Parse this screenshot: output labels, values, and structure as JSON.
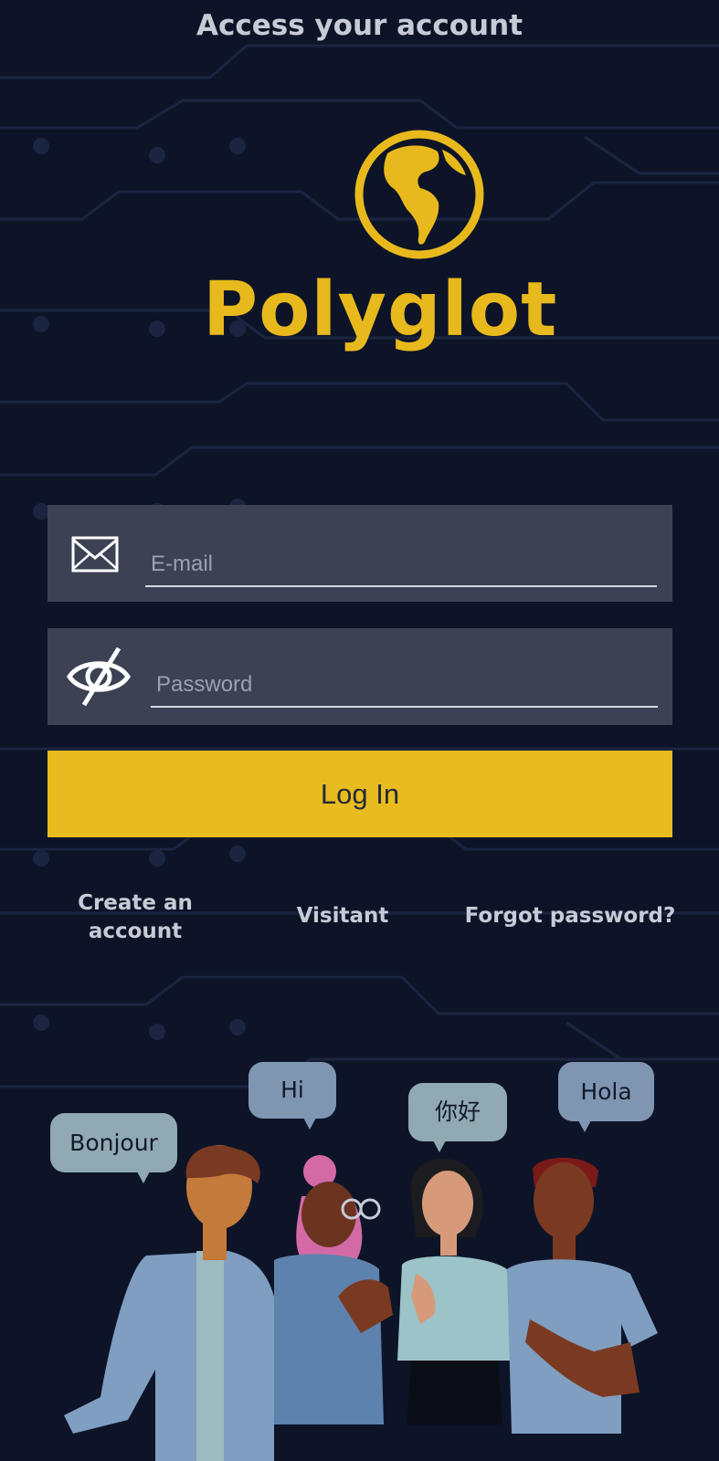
{
  "header": {
    "title": "Access your account"
  },
  "logo": {
    "text": "Polyglot",
    "icon": "globe-americas-icon",
    "color": "#e8b91c"
  },
  "form": {
    "email": {
      "placeholder": "E-mail",
      "value": "",
      "icon": "envelope-icon"
    },
    "password": {
      "placeholder": "Password",
      "value": "",
      "icon": "eye-off-icon"
    },
    "login_label": "Log In"
  },
  "links": {
    "create_account": "Create an account",
    "visitant": "Visitant",
    "forgot_password": "Forgot password?"
  },
  "illustration": {
    "bubbles": [
      "Bonjour",
      "Hi",
      "你好",
      "Hola"
    ]
  },
  "colors": {
    "background": "#0d1428",
    "accent": "#e8bb1f",
    "field": "#3c4254",
    "text_light": "#c7cbd6"
  }
}
